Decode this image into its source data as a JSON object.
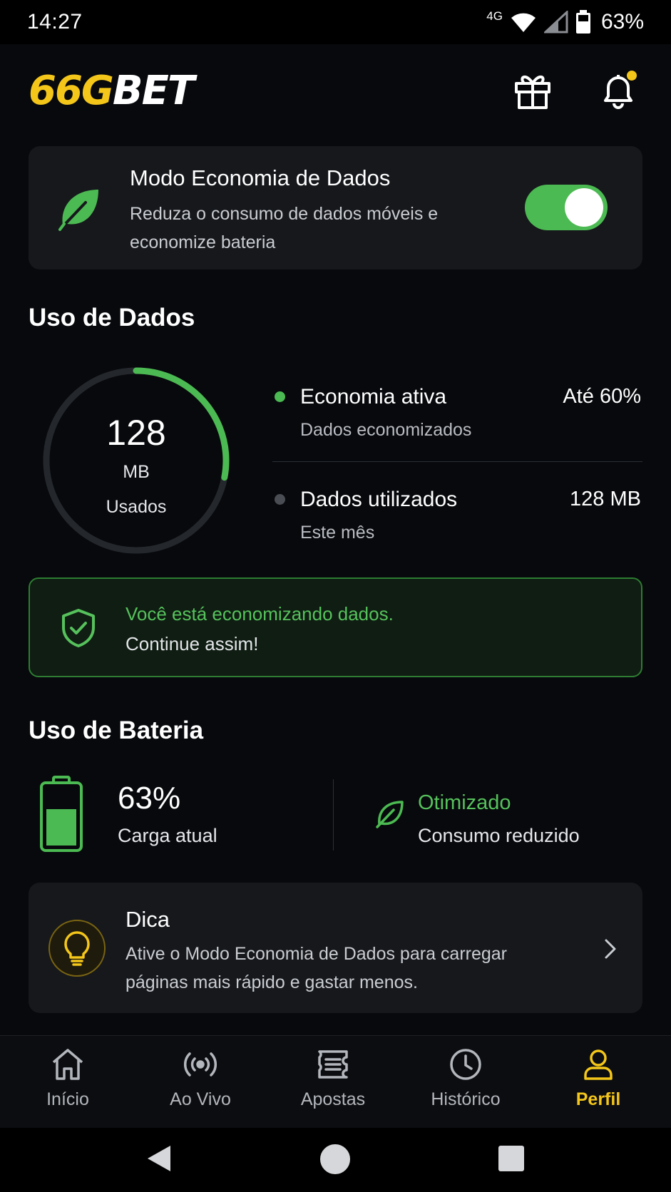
{
  "status_bar": {
    "time": "14:27",
    "network": "4G",
    "battery": "63%"
  },
  "header": {
    "logo_part1": "66G",
    "logo_part2": "BET",
    "icons": [
      "gift-icon",
      "bell-icon"
    ]
  },
  "economy_mode": {
    "title": "Modo Economia de Dados",
    "description": "Reduza o consumo de dados móveis e economize bateria",
    "enabled": true
  },
  "data_usage": {
    "section_title": "Uso de Dados",
    "ring": {
      "value": "128",
      "unit": "MB",
      "label": "Usados",
      "fill_fraction": 0.28
    },
    "stats": [
      {
        "title": "Economia ativa",
        "subtitle": "Dados economizados",
        "value": "Até 60%"
      },
      {
        "title": "Dados utilizados",
        "subtitle": "Este mês",
        "value": "128 MB"
      }
    ],
    "banner": {
      "line1": "Você está economizando dados.",
      "line2": "Continue assim!"
    }
  },
  "battery_usage": {
    "section_title": "Uso de Bateria",
    "percent": "63%",
    "label": "Carga atual",
    "level_fraction": 0.63,
    "status_title": "Otimizado",
    "status_subtitle": "Consumo reduzido"
  },
  "tip": {
    "title": "Dica",
    "description": "Ative o Modo Economia de Dados para carregar páginas mais rápido e gastar menos."
  },
  "bottom_nav": {
    "items": [
      {
        "label": "Início",
        "icon": "home-icon"
      },
      {
        "label": "Ao Vivo",
        "icon": "live-icon"
      },
      {
        "label": "Apostas",
        "icon": "ticket-icon"
      },
      {
        "label": "Histórico",
        "icon": "clock-icon"
      },
      {
        "label": "Perfil",
        "icon": "user-icon"
      }
    ],
    "active": "Perfil"
  },
  "colors": {
    "accent_yellow": "#f4c61a",
    "accent_green": "#4cba52",
    "background": "#07090c",
    "card": "#16181c"
  }
}
